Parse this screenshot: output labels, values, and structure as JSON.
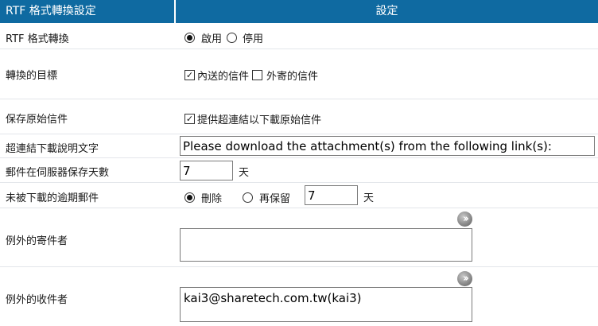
{
  "header": {
    "left": "RTF 格式轉換設定",
    "right": "設定"
  },
  "rtf": {
    "label": "RTF 格式轉換",
    "enable": "啟用",
    "disable": "停用"
  },
  "target": {
    "label": "轉換的目標",
    "internal": "內送的信件",
    "external": "外寄的信件"
  },
  "keep": {
    "label": "保存原始信件",
    "option": "提供超連結以下載原始信件"
  },
  "link_text": {
    "label": "超連結下載說明文字",
    "value": "Please download the attachment(s) from the following link(s):"
  },
  "days": {
    "label": "郵件在伺服器保存天數",
    "value": "7",
    "unit": "天"
  },
  "expired": {
    "label": "未被下載的逾期郵件",
    "delete": "刪除",
    "retain": "再保留",
    "value": "7",
    "unit": "天"
  },
  "except_sender": {
    "label": "例外的寄件者",
    "value": ""
  },
  "except_recipient": {
    "label": "例外的收件者",
    "value": "kai3@sharetech.com.tw(kai3)"
  },
  "icons": {
    "expand": "double-chevron-right-icon"
  }
}
